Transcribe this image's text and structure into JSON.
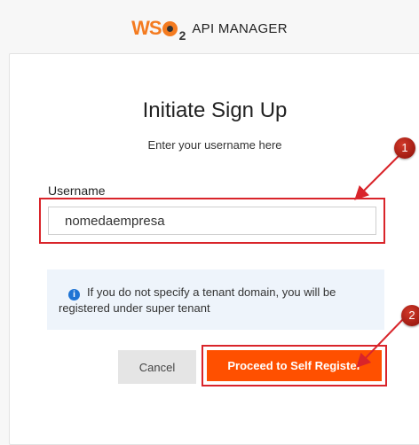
{
  "header": {
    "logo_text": "API MANAGER"
  },
  "form": {
    "title": "Initiate Sign Up",
    "subtitle": "Enter your username here",
    "username_label": "Username",
    "username_value": "nomedaempresa",
    "info_message": "If you do not specify a tenant domain, you will be registered under super tenant",
    "cancel_label": "Cancel",
    "proceed_label": "Proceed to Self Register"
  },
  "annotations": {
    "marker_1": "1",
    "marker_2": "2",
    "highlight_color": "#d9242a"
  },
  "colors": {
    "brand": "#f47b20",
    "primary_button": "#ff5000",
    "info_bg": "#eef4fb"
  }
}
